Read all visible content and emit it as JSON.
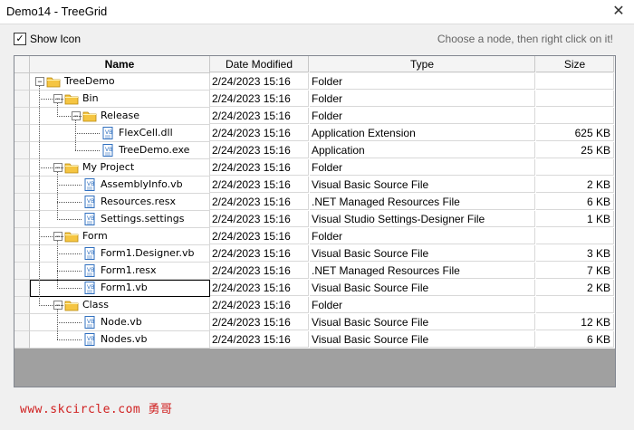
{
  "window": {
    "title": "Demo14 - TreeGrid",
    "close_glyph": "✕"
  },
  "toolbar": {
    "show_icon_label": "Show Icon",
    "show_icon_checked": true,
    "hint": "Choose a node, then right click on it!"
  },
  "grid": {
    "columns": [
      "Name",
      "Date Modified",
      "Type",
      "Size"
    ],
    "rows": [
      {
        "name": "TreeDemo",
        "date": "2/24/2023 15:16",
        "type": "Folder",
        "size": "",
        "level": 0,
        "kind": "folder",
        "expanded": true
      },
      {
        "name": "Bin",
        "date": "2/24/2023 15:16",
        "type": "Folder",
        "size": "",
        "level": 1,
        "kind": "folder",
        "expanded": true
      },
      {
        "name": "Release",
        "date": "2/24/2023 15:16",
        "type": "Folder",
        "size": "",
        "level": 2,
        "kind": "folder",
        "expanded": true
      },
      {
        "name": "FlexCell.dll",
        "date": "2/24/2023 15:16",
        "type": "Application Extension",
        "size": "625 KB",
        "level": 3,
        "kind": "file"
      },
      {
        "name": "TreeDemo.exe",
        "date": "2/24/2023 15:16",
        "type": "Application",
        "size": "25 KB",
        "level": 3,
        "kind": "file"
      },
      {
        "name": "My Project",
        "date": "2/24/2023 15:16",
        "type": "Folder",
        "size": "",
        "level": 1,
        "kind": "folder",
        "expanded": true
      },
      {
        "name": "AssemblyInfo.vb",
        "date": "2/24/2023 15:16",
        "type": "Visual Basic Source File",
        "size": "2 KB",
        "level": 2,
        "kind": "file"
      },
      {
        "name": "Resources.resx",
        "date": "2/24/2023 15:16",
        "type": ".NET Managed Resources File",
        "size": "6 KB",
        "level": 2,
        "kind": "file"
      },
      {
        "name": "Settings.settings",
        "date": "2/24/2023 15:16",
        "type": "Visual Studio Settings-Designer File",
        "size": "1 KB",
        "level": 2,
        "kind": "file"
      },
      {
        "name": "Form",
        "date": "2/24/2023 15:16",
        "type": "Folder",
        "size": "",
        "level": 1,
        "kind": "folder",
        "expanded": true
      },
      {
        "name": "Form1.Designer.vb",
        "date": "2/24/2023 15:16",
        "type": "Visual Basic Source File",
        "size": "3 KB",
        "level": 2,
        "kind": "file"
      },
      {
        "name": "Form1.resx",
        "date": "2/24/2023 15:16",
        "type": ".NET Managed Resources File",
        "size": "7 KB",
        "level": 2,
        "kind": "file"
      },
      {
        "name": "Form1.vb",
        "date": "2/24/2023 15:16",
        "type": "Visual Basic Source File",
        "size": "2 KB",
        "level": 2,
        "kind": "file",
        "selected": true
      },
      {
        "name": "Class",
        "date": "2/24/2023 15:16",
        "type": "Folder",
        "size": "",
        "level": 1,
        "kind": "folder",
        "expanded": true
      },
      {
        "name": "Node.vb",
        "date": "2/24/2023 15:16",
        "type": "Visual Basic Source File",
        "size": "12 KB",
        "level": 2,
        "kind": "file"
      },
      {
        "name": "Nodes.vb",
        "date": "2/24/2023 15:16",
        "type": "Visual Basic Source File",
        "size": "6 KB",
        "level": 2,
        "kind": "file"
      }
    ]
  },
  "watermark": "www.skcircle.com 勇哥",
  "colors": {
    "folder": "#f5c542",
    "file_icon": "#2f6fbf",
    "watermark": "#d02020"
  }
}
